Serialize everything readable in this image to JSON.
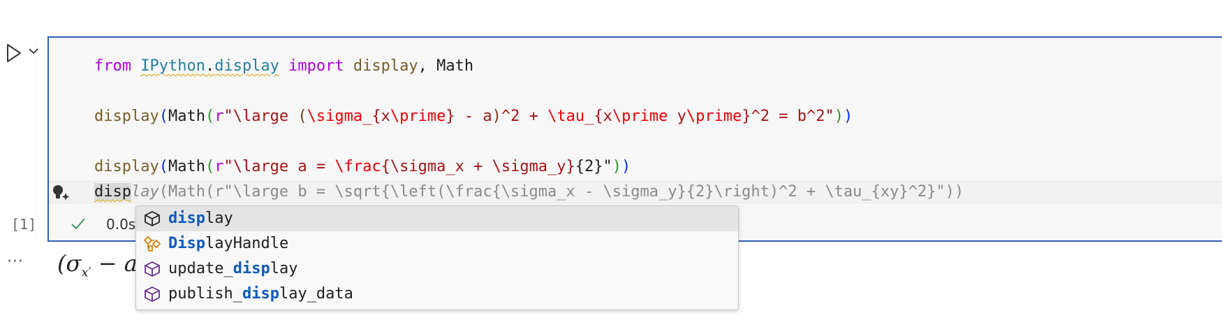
{
  "gutter": {
    "run_icon": "play-icon",
    "chevron_icon": "chevron-down-icon",
    "execution_count": "[1]",
    "output_menu": "···"
  },
  "code": {
    "line1": {
      "kw_from": "from",
      "mod_ipython": "IPython",
      "dot": ".",
      "mod_display": "display",
      "kw_import": "import",
      "fn_display": "display",
      "sep": ", Math"
    },
    "line2": {
      "fn": "display",
      "open": "(",
      "math": "Math",
      "open2": "(",
      "prefix": "r",
      "str_a": "\"\\large ",
      "paren_open": "(",
      "esc_sigma": "\\sigma",
      "str_b": "_{x",
      "esc_prime": "\\prime",
      "str_c": "} - a",
      "paren_close": ")",
      "str_d": "^2 + ",
      "esc_tau": "\\tau",
      "str_e": "_{x",
      "esc_prime2": "\\prime",
      "str_f": " y",
      "esc_prime3": "\\prime",
      "str_g": "}^2 = b^2\"",
      "close2": ")",
      "close": ")"
    },
    "line3": {
      "fn": "display",
      "open": "(",
      "math": "Math",
      "open2": "(",
      "prefix": "r",
      "str_a": "\"\\large a = ",
      "esc_frac": "\\frac",
      "str_b": "{\\sigma_x + \\sigma_y}",
      "str_c": "{2}\"",
      "close2": ")",
      "close": ")"
    },
    "line4": {
      "typed": "disp",
      "ghost_italic": "lay",
      "ghost": "(Math(r\"\\large b = \\sqrt{\\left(\\frac{\\sigma_x - \\sigma_y}{2}\\right)^2 + \\tau_{xy}^2}\"))"
    }
  },
  "status": {
    "icon": "check-icon",
    "time": "0.0s"
  },
  "output": {
    "math_open": "(σ",
    "math_sub": "x′",
    "math_rest": " − a"
  },
  "suggestions": [
    {
      "icon": "method-cube-icon",
      "match": "disp",
      "rest": "lay",
      "pre": "",
      "selected": true,
      "icon_color": "#1f1f1f"
    },
    {
      "icon": "class-icon",
      "match": "Disp",
      "rest": "layHandle",
      "pre": "",
      "selected": false,
      "icon_color": "#d67e00"
    },
    {
      "icon": "method-cube-icon",
      "match": "disp",
      "rest": "lay",
      "pre": "update_",
      "selected": false,
      "icon_color": "#652d90"
    },
    {
      "icon": "method-cube-icon",
      "match": "disp",
      "rest": "lay_data",
      "pre": "publish_",
      "selected": false,
      "icon_color": "#652d90"
    }
  ],
  "colors": {
    "cell_border": "#2a62b4",
    "highlight": "#0f5bbd",
    "check": "#3a9b5c"
  }
}
